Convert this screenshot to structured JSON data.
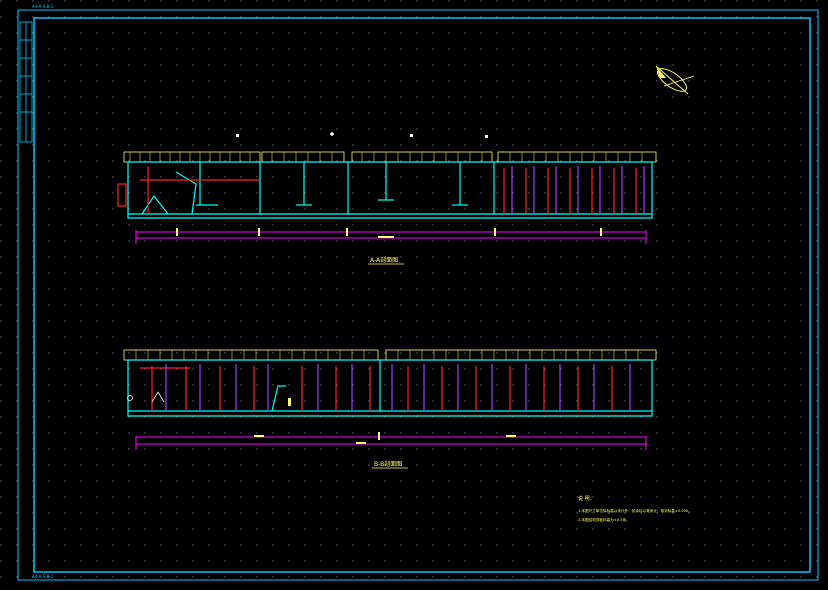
{
  "header": {
    "corner_label_top": "A4-A-S-B-1",
    "corner_label_bottom": "A4-A-S-B-1"
  },
  "section_a": {
    "title": "A-A剖面图"
  },
  "section_b": {
    "title": "B-B剖面图"
  },
  "notes": {
    "heading": "说 明：",
    "line1": "1.本图尺寸单位除标高以米计外，其余均以毫米计，相对标高±0.000。",
    "line2": "2.本图结构顶板标高为±0.5米。"
  },
  "colors": {
    "frame": "#00c8ff",
    "cyan": "#00ffff",
    "yellow": "#ffff66",
    "red": "#ff2020",
    "magenta": "#ff00ff",
    "purple": "#a040ff",
    "white": "#ffffff",
    "grid_dot": "#6a6a8a"
  },
  "icons": {
    "north_arrow": "north-arrow-icon"
  }
}
